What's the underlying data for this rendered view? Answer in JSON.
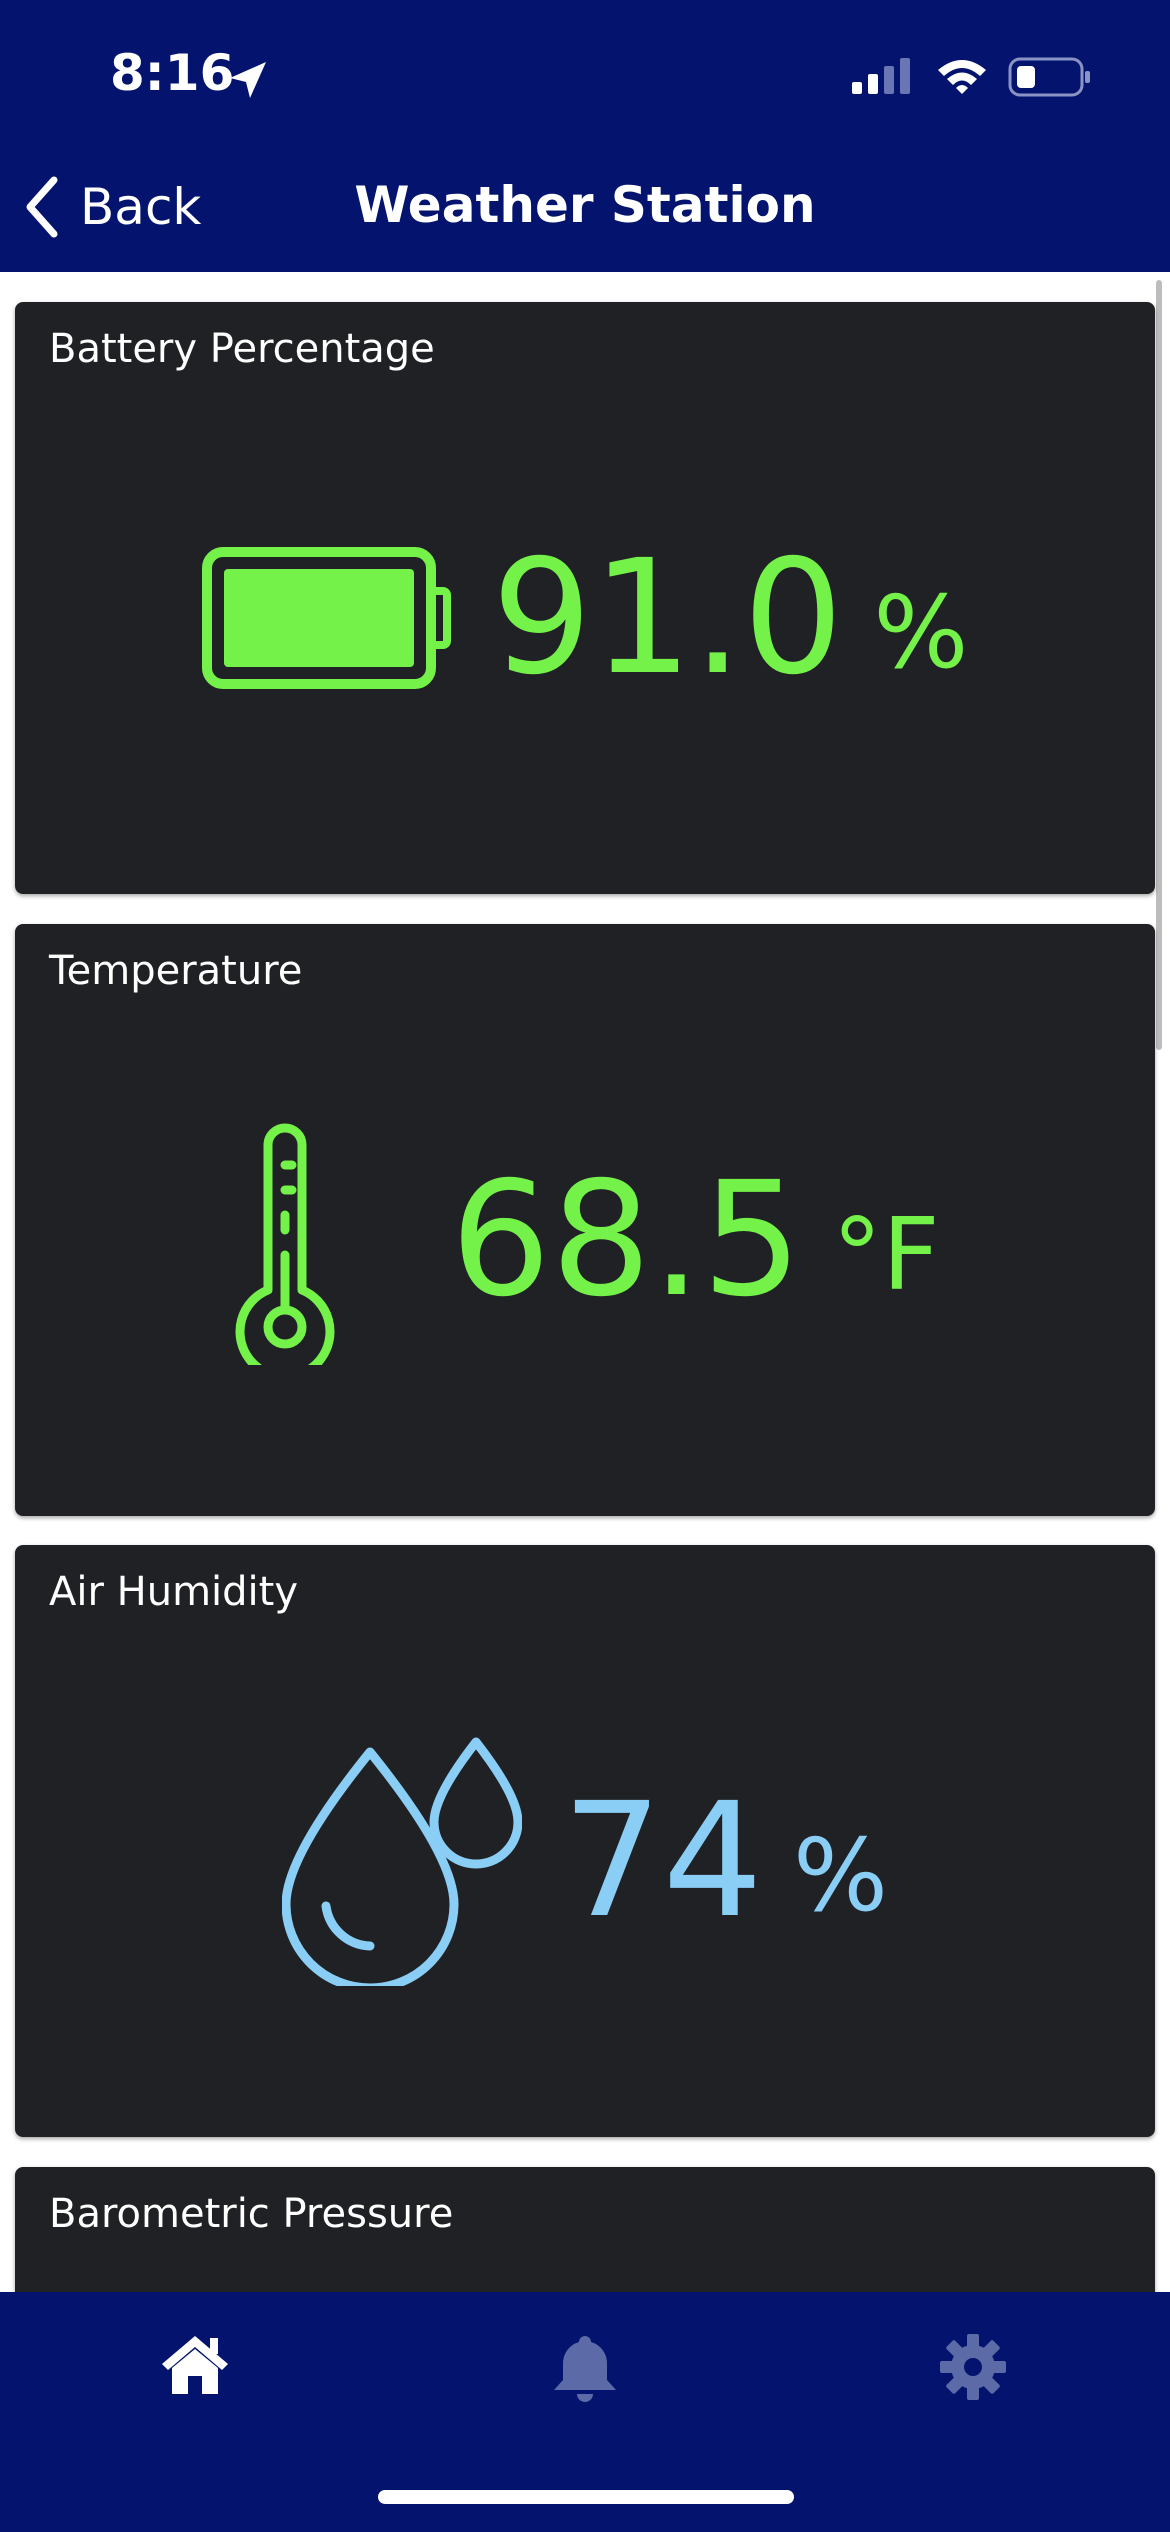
{
  "status_bar": {
    "time": "8:16"
  },
  "header": {
    "back_label": "Back",
    "title": "Weather Station"
  },
  "cards": [
    {
      "title": "Battery Percentage",
      "value": "91.0",
      "unit": "%",
      "icon": "battery-icon",
      "color": "#74f24a"
    },
    {
      "title": "Temperature",
      "value": "68.5",
      "unit": "°F",
      "icon": "thermometer-icon",
      "color": "#74f24a"
    },
    {
      "title": "Air Humidity",
      "value": "74",
      "unit": "%",
      "icon": "water-drops-icon",
      "color": "#8acef6"
    },
    {
      "title": "Barometric Pressure"
    }
  ],
  "tabbar": {
    "items": [
      "home-icon",
      "bell-icon",
      "gear-icon"
    ],
    "active": "home-icon"
  },
  "colors": {
    "header_bg": "#04146e",
    "card_bg": "#202124",
    "green": "#74f24a",
    "blue": "#8acef6",
    "inactive_tab": "#5c6aa8"
  }
}
